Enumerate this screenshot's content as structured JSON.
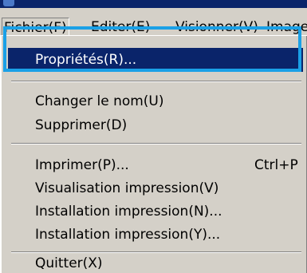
{
  "menubar": {
    "items": [
      {
        "label": "Fichier(F)"
      },
      {
        "label": "Editer(E)"
      },
      {
        "label": "Visionner(V)"
      },
      {
        "label": "Image"
      }
    ]
  },
  "dropdown": {
    "items": [
      {
        "label": "Propriétés(R)...",
        "highlighted": true
      },
      {
        "label": "Changer le nom(U)"
      },
      {
        "label": "Supprimer(D)"
      },
      {
        "label": "Imprimer(P)...",
        "shortcut": "Ctrl+P"
      },
      {
        "label": "Visualisation impression(V)"
      },
      {
        "label": "Installation impression(N)..."
      },
      {
        "label": "Installation impression(Y)..."
      },
      {
        "label": "Quitter(X)"
      }
    ]
  },
  "colors": {
    "highlight": "#0a246a",
    "annotation": "#1aa0e6",
    "face": "#d4d0c8"
  }
}
